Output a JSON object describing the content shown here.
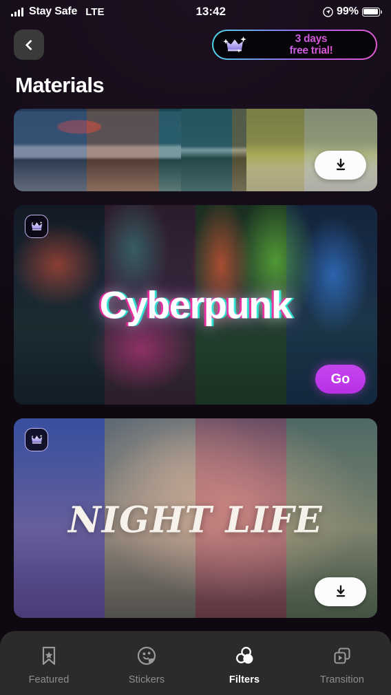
{
  "statusbar": {
    "carrier": "Stay Safe",
    "network": "LTE",
    "time": "13:42",
    "battery_percent": "99%",
    "signal_icon": "signal-bars-icon",
    "location_icon": "location-arrow-icon",
    "battery_icon": "battery-icon"
  },
  "header": {
    "back_icon": "chevron-left-icon",
    "trial_line1": "3 days",
    "trial_line2": "free trial!",
    "trial_crown_icon": "crown-sparkle-icon"
  },
  "page": {
    "title": "Materials"
  },
  "cards": [
    {
      "id": "card-filter-truck",
      "title": "",
      "premium": false,
      "action_label": "",
      "action_icon": "download-icon",
      "strip_count": 5
    },
    {
      "id": "card-filter-cyberpunk",
      "title": "Cyberpunk",
      "premium": true,
      "action_label": "Go",
      "action_icon": "go-button",
      "crown_icon": "crown-icon",
      "strip_count": 4
    },
    {
      "id": "card-filter-nightlife",
      "title": "NIGHT LIFE",
      "premium": true,
      "action_label": "",
      "action_icon": "download-icon",
      "crown_icon": "crown-icon",
      "strip_count": 4
    }
  ],
  "tabs": [
    {
      "label": "Featured",
      "icon": "bookmark-star-icon",
      "active": false
    },
    {
      "label": "Stickers",
      "icon": "sticker-face-icon",
      "active": false
    },
    {
      "label": "Filters",
      "icon": "color-circles-icon",
      "active": true
    },
    {
      "label": "Transition",
      "icon": "video-frames-icon",
      "active": false
    }
  ],
  "colors": {
    "background": "#120a14",
    "tabbar": "#2b2b2b",
    "accent_go": "#bf38e8",
    "accent_active": "#ffffff",
    "trial_gradient_start": "#4fd8e8",
    "trial_gradient_end": "#e05bd0"
  }
}
